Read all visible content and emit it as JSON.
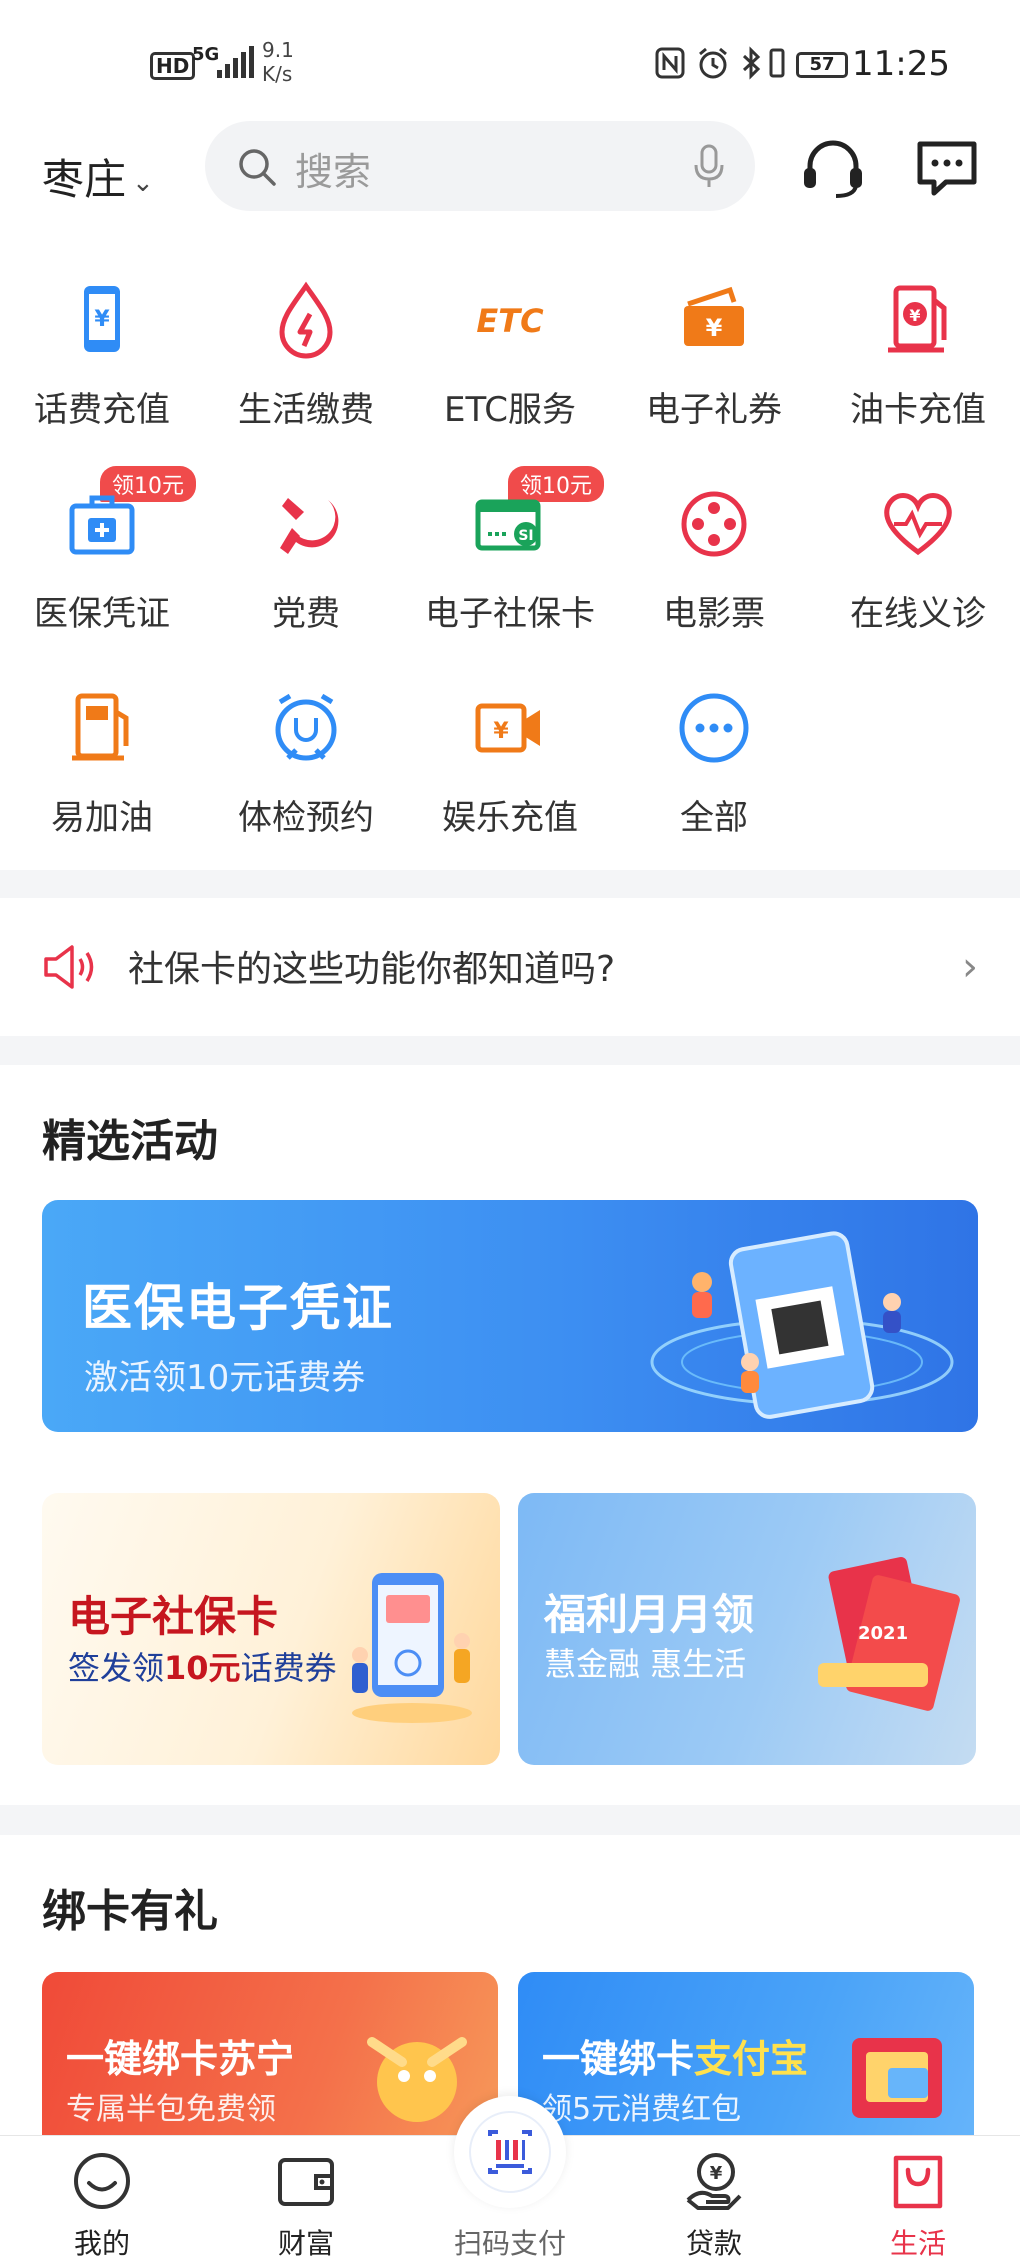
{
  "status_bar": {
    "hd": "HD",
    "network": "5G",
    "speed_value": "9.1",
    "speed_unit": "K/s",
    "battery": "57",
    "time": "11:25"
  },
  "header": {
    "city": "枣庄",
    "search_placeholder": "搜索"
  },
  "grid": [
    {
      "label": "话费充值",
      "icon": "phone-recharge-icon",
      "badge": ""
    },
    {
      "label": "生活缴费",
      "icon": "utility-payment-icon",
      "badge": ""
    },
    {
      "label": "ETC服务",
      "icon": "etc-icon",
      "badge": ""
    },
    {
      "label": "电子礼券",
      "icon": "coupon-icon",
      "badge": ""
    },
    {
      "label": "油卡充值",
      "icon": "fuel-card-icon",
      "badge": ""
    },
    {
      "label": "医保凭证",
      "icon": "medical-insurance-icon",
      "badge": "领10元"
    },
    {
      "label": "党费",
      "icon": "party-fee-icon",
      "badge": ""
    },
    {
      "label": "电子社保卡",
      "icon": "social-security-card-icon",
      "badge": "领10元"
    },
    {
      "label": "电影票",
      "icon": "film-reel-icon",
      "badge": ""
    },
    {
      "label": "在线义诊",
      "icon": "heartbeat-icon",
      "badge": ""
    },
    {
      "label": "易加油",
      "icon": "gas-pump-icon",
      "badge": ""
    },
    {
      "label": "体检预约",
      "icon": "stethoscope-clock-icon",
      "badge": ""
    },
    {
      "label": "娱乐充值",
      "icon": "video-recharge-icon",
      "badge": ""
    },
    {
      "label": "全部",
      "icon": "more-icon",
      "badge": ""
    }
  ],
  "notice": {
    "text": "社保卡的这些功能你都知道吗?"
  },
  "featured": {
    "title": "精选活动",
    "big_banner": {
      "title": "医保电子凭证",
      "subtitle": "激活领10元话费券"
    },
    "left_banner": {
      "title": "电子社保卡",
      "subtitle_pre": "签发领",
      "subtitle_em": "10元",
      "subtitle_post": "话费券"
    },
    "right_banner": {
      "title": "福利月月领",
      "subtitle": "慧金融  惠生活",
      "year": "2021"
    }
  },
  "bind": {
    "title": "绑卡有礼",
    "left_card": {
      "title": "一键绑卡苏宁",
      "subtitle": "专属半包免费领"
    },
    "right_card": {
      "title_pre": "一键绑卡",
      "title_em": "支付宝",
      "subtitle": "领5元消费红包"
    }
  },
  "tabs": [
    {
      "label": "我的",
      "icon": "profile-icon"
    },
    {
      "label": "财富",
      "icon": "wallet-icon"
    },
    {
      "label": "扫码支付",
      "icon": "scan-icon"
    },
    {
      "label": "贷款",
      "icon": "loan-icon"
    },
    {
      "label": "生活",
      "icon": "shopping-bag-icon"
    }
  ],
  "colors": {
    "brand_blue": "#2f7cf6",
    "active_red": "#e8334a",
    "badge_red": "#f04b4b"
  }
}
